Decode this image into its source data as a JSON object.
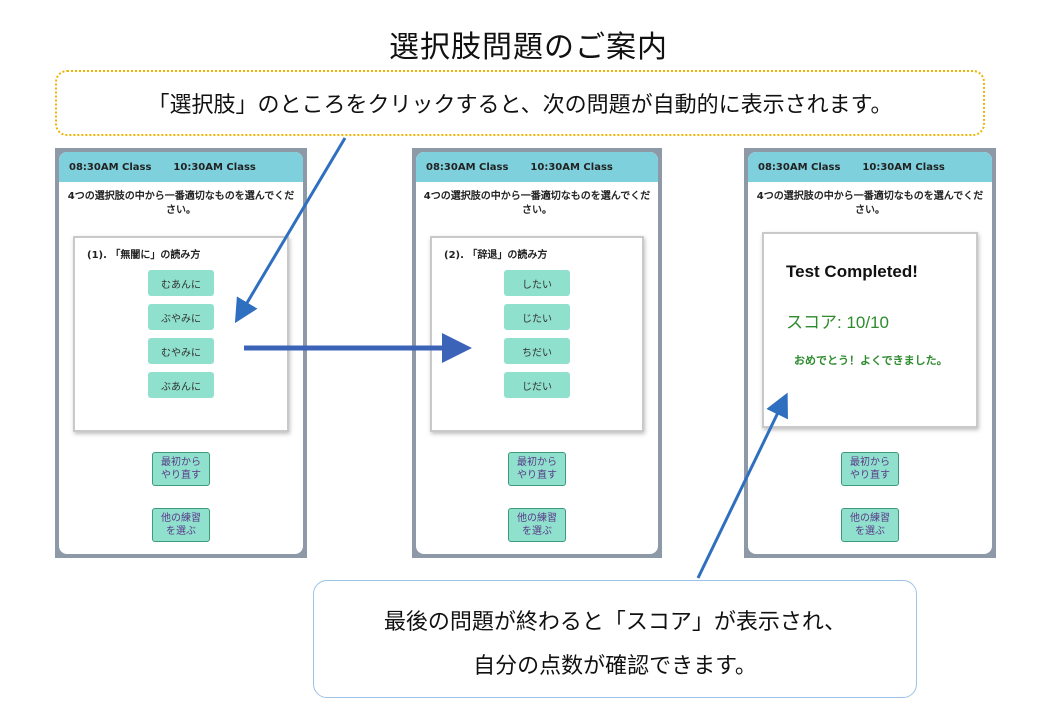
{
  "title": "選択肢問題のご案内",
  "callout_top": "「選択肢」のところをクリックすると、次の問題が自動的に表示されます。",
  "callout_bottom": [
    "最後の問題が終わると「スコア」が表示され、",
    "自分の点数が確認できます。"
  ],
  "screens": [
    {
      "tabs": [
        "08:30AM Class",
        "10:30AM Class"
      ],
      "instruction": "4つの選択肢の中から一番適切なものを選んでください。",
      "question": "(1). 「無闇に」の読み方",
      "options": [
        "むあんに",
        "ぶやみに",
        "むやみに",
        "ぶあんに"
      ],
      "restart_label": "最初からやり直す",
      "other_label": "他の練習を選ぶ"
    },
    {
      "tabs": [
        "08:30AM Class",
        "10:30AM Class"
      ],
      "instruction": "4つの選択肢の中から一番適切なものを選んでください。",
      "question": "(2). 「辞退」の読み方",
      "options": [
        "したい",
        "じたい",
        "ちだい",
        "じだい"
      ],
      "restart_label": "最初からやり直す",
      "other_label": "他の練習を選ぶ"
    },
    {
      "tabs": [
        "08:30AM Class",
        "10:30AM Class"
      ],
      "instruction": "4つの選択肢の中から一番適切なものを選んでください。",
      "result_title": "Test Completed!",
      "score": "スコア: 10/10",
      "message": "おめでとう！よくできました。",
      "restart_label": "最初からやり直す",
      "other_label": "他の練習を選ぶ"
    }
  ],
  "colors": {
    "topbar": "#7fd0dd",
    "option": "#8fe0cc",
    "arrow": "#2f6fbf",
    "callout_top_border": "#f0b400",
    "score_green": "#2e8b2e"
  }
}
